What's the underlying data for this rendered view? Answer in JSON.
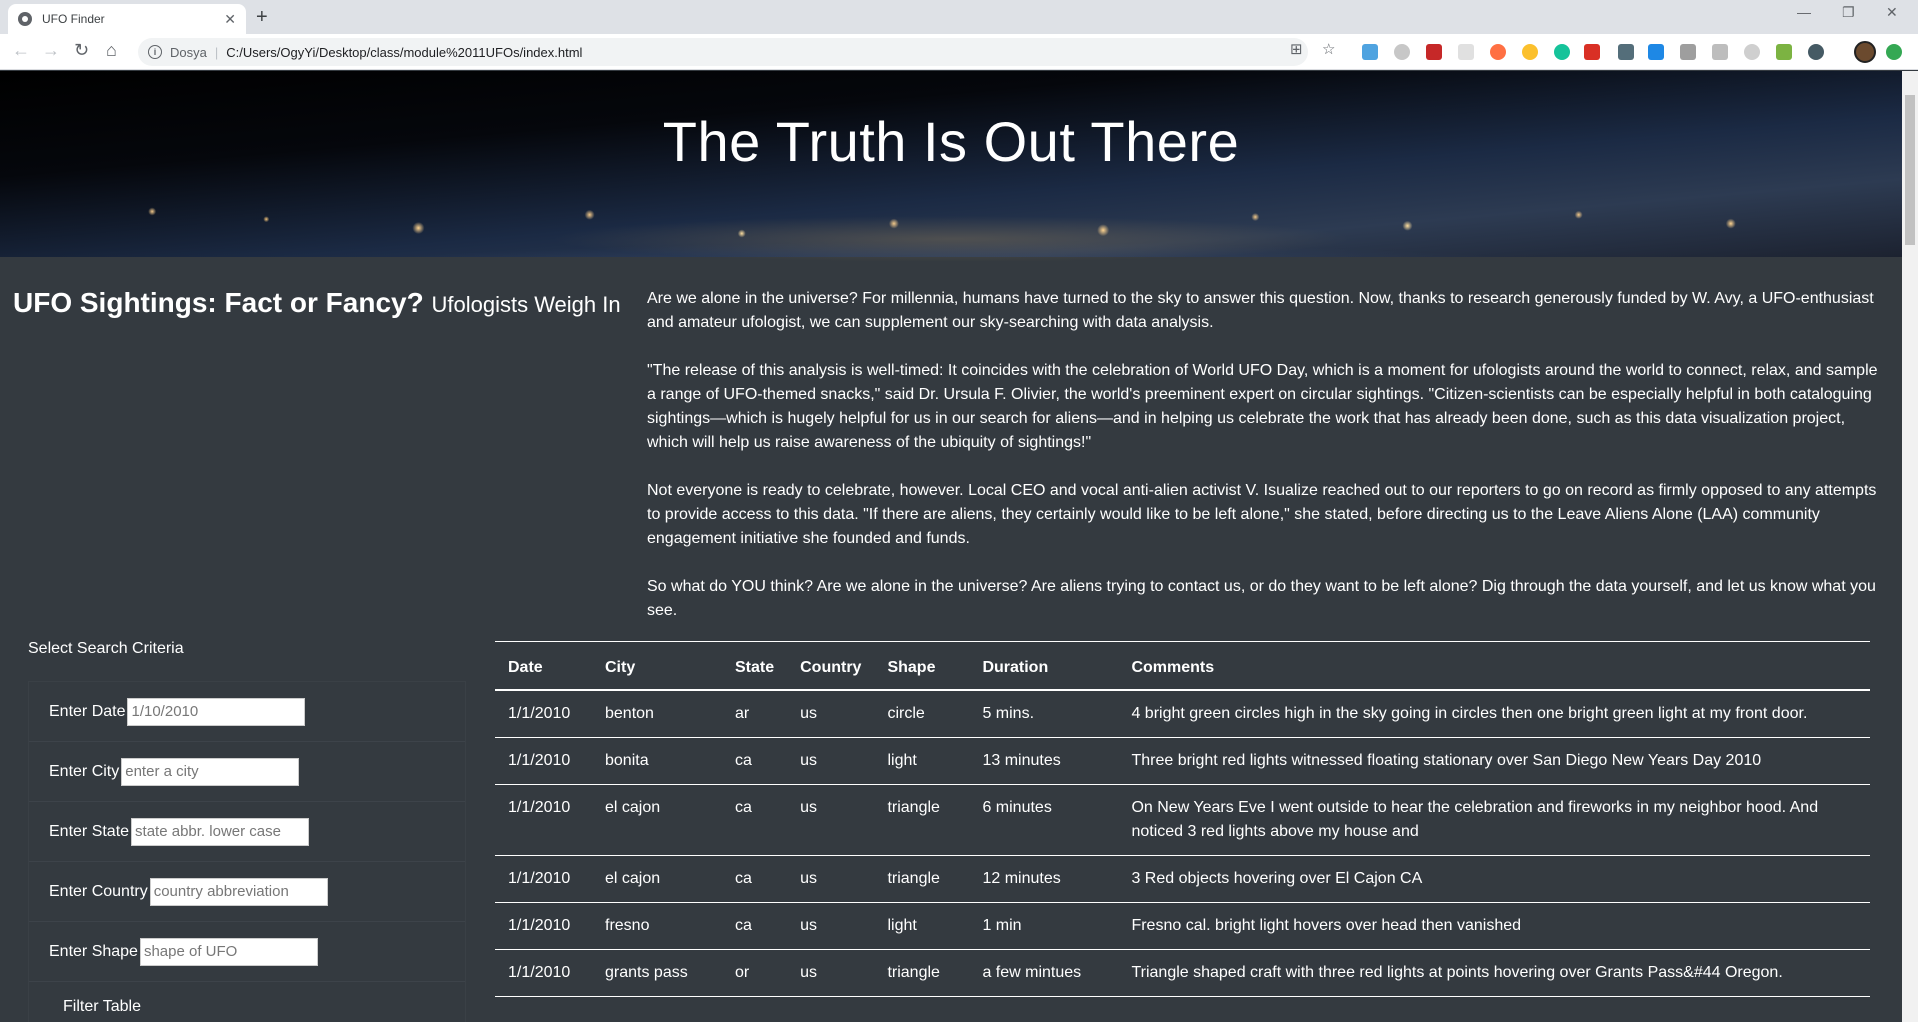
{
  "browser": {
    "tab_title": "UFO Finder",
    "site_label": "Dosya",
    "url": "C:/Users/OgyYi/Desktop/class/module%2011UFOs/index.html"
  },
  "hero": {
    "title": "The Truth Is Out There"
  },
  "headline": {
    "main": "UFO Sightings: Fact or Fancy?",
    "sub": "Ufologists Weigh In"
  },
  "article": {
    "paragraphs": [
      "Are we alone in the universe? For millennia, humans have turned to the sky to answer this question. Now, thanks to research generously funded by W. Avy, a UFO-enthusiast and amateur ufologist, we can supplement our sky-searching with data analysis.",
      "\"The release of this analysis is well-timed: It coincides with the celebration of World UFO Day, which is a moment for ufologists around the world to connect, relax, and sample a range of UFO-themed snacks,\" said Dr. Ursula F. Olivier, the world's preeminent expert on circular sightings. \"Citizen-scientists can be especially helpful in both cataloguing sightings—which is hugely helpful for us in our search for aliens—and in helping us celebrate the work that has already been done, such as this data visualization project, which will help us raise awareness of the ubiquity of sightings!\"",
      "Not everyone is ready to celebrate, however. Local CEO and vocal anti-alien activist V. Isualize reached out to our reporters to go on record as firmly opposed to any attempts to provide access to this data. \"If there are aliens, they certainly would like to be left alone,\" she stated, before directing us to the Leave Aliens Alone (LAA) community engagement initiative she founded and funds.",
      "So what do YOU think? Are we alone in the universe? Are aliens trying to contact us, or do they want to be left alone? Dig through the data yourself, and let us know what you see."
    ]
  },
  "filters": {
    "title": "Select Search Criteria",
    "date_label": "Enter Date",
    "date_placeholder": "1/10/2010",
    "city_label": "Enter City",
    "city_placeholder": "enter a city",
    "state_label": "Enter State",
    "state_placeholder": "state abbr. lower case",
    "country_label": "Enter Country",
    "country_placeholder": "country abbreviation",
    "shape_label": "Enter Shape",
    "shape_placeholder": "shape of UFO",
    "button": "Filter Table"
  },
  "table": {
    "headers": [
      "Date",
      "City",
      "State",
      "Country",
      "Shape",
      "Duration",
      "Comments"
    ],
    "rows": [
      [
        "1/1/2010",
        "benton",
        "ar",
        "us",
        "circle",
        "5 mins.",
        "4 bright green circles high in the sky going in circles then one bright green light at my front door."
      ],
      [
        "1/1/2010",
        "bonita",
        "ca",
        "us",
        "light",
        "13 minutes",
        "Three bright red lights witnessed floating stationary over San Diego New Years Day 2010"
      ],
      [
        "1/1/2010",
        "el cajon",
        "ca",
        "us",
        "triangle",
        "6 minutes",
        "On New Years Eve I went outside to hear the celebration and fireworks in my neighbor hood. And noticed 3 red lights above my house and"
      ],
      [
        "1/1/2010",
        "el cajon",
        "ca",
        "us",
        "triangle",
        "12 minutes",
        "3 Red objects hovering over El Cajon CA"
      ],
      [
        "1/1/2010",
        "fresno",
        "ca",
        "us",
        "light",
        "1 min",
        "Fresno cal. bright light hovers over head then vanished"
      ],
      [
        "1/1/2010",
        "grants pass",
        "or",
        "us",
        "triangle",
        "a few mintues",
        "Triangle shaped craft with three red lights at points hovering over Grants Pass&#44 Oregon."
      ]
    ]
  }
}
